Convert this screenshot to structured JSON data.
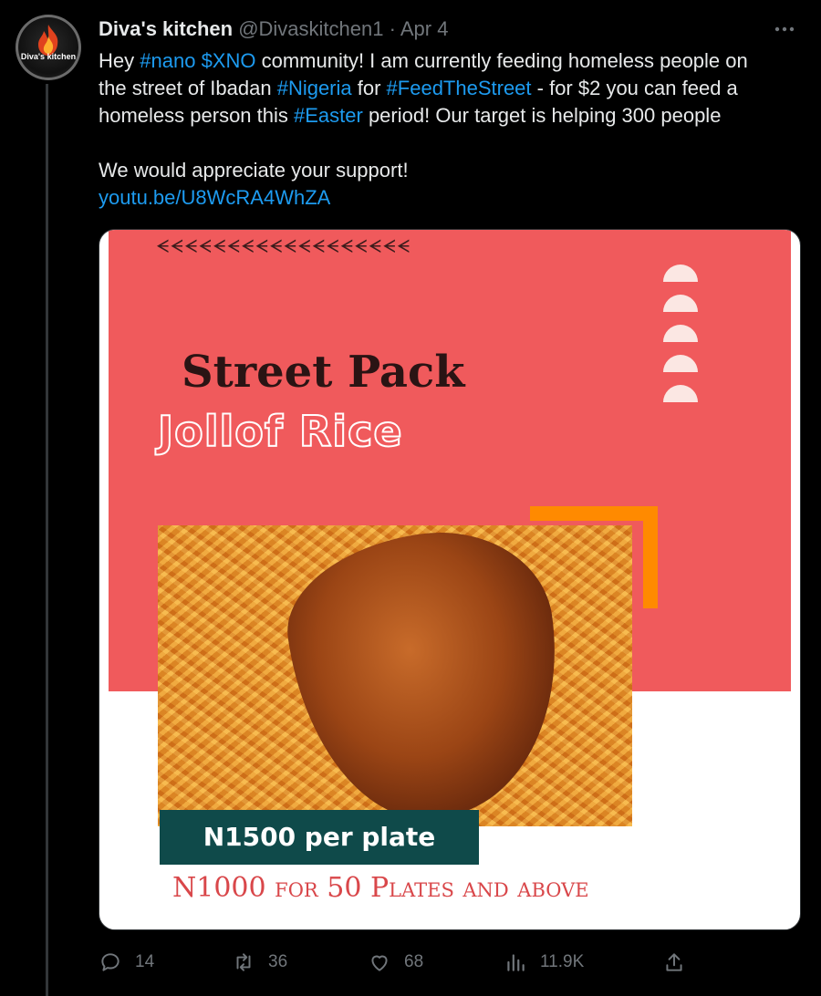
{
  "tweet": {
    "display_name": "Diva's kitchen",
    "handle": "@Divaskitchen1",
    "date_sep": " · ",
    "date": "Apr 4",
    "avatar_text": "Diva's kitchen",
    "text_segments": [
      {
        "t": "Hey ",
        "link": false
      },
      {
        "t": "#nano",
        "link": true
      },
      {
        "t": " ",
        "link": false
      },
      {
        "t": "$XNO",
        "link": true
      },
      {
        "t": " community! I am currently feeding homeless people on\nthe street of Ibadan ",
        "link": false
      },
      {
        "t": "#Nigeria",
        "link": true
      },
      {
        "t": " for ",
        "link": false
      },
      {
        "t": "#FeedTheStreet",
        "link": true
      },
      {
        "t": " - for $2 you can feed a\nhomeless person this ",
        "link": false
      },
      {
        "t": "#Easter",
        "link": true
      },
      {
        "t": " period! Our target is helping 300 people\n\nWe would appreciate your support!\n",
        "link": false
      },
      {
        "t": "youtu.be/U8WcRA4WhZA",
        "link": true
      }
    ]
  },
  "media": {
    "chevrons": "ᗕᗕᗕᗕᗕᗕᗕᗕᗕᗕᗕᗕᗕᗕᗕᗕᗕᗕ",
    "title_line1": "Street Pack",
    "title_line2": "Jollof Rice",
    "price": "N1500 per plate",
    "bulk_offer": "N1000 for 50 Plates and above",
    "accent_color": "#f05a5c",
    "frame_color": "#ff8a00",
    "price_bg": "#0f4a4a"
  },
  "actions": {
    "replies": "14",
    "retweets": "36",
    "likes": "68",
    "views": "11.9K"
  },
  "colors": {
    "link": "#1d9bf0",
    "muted": "#71767b",
    "text": "#e7e9ea",
    "background": "#000000"
  }
}
